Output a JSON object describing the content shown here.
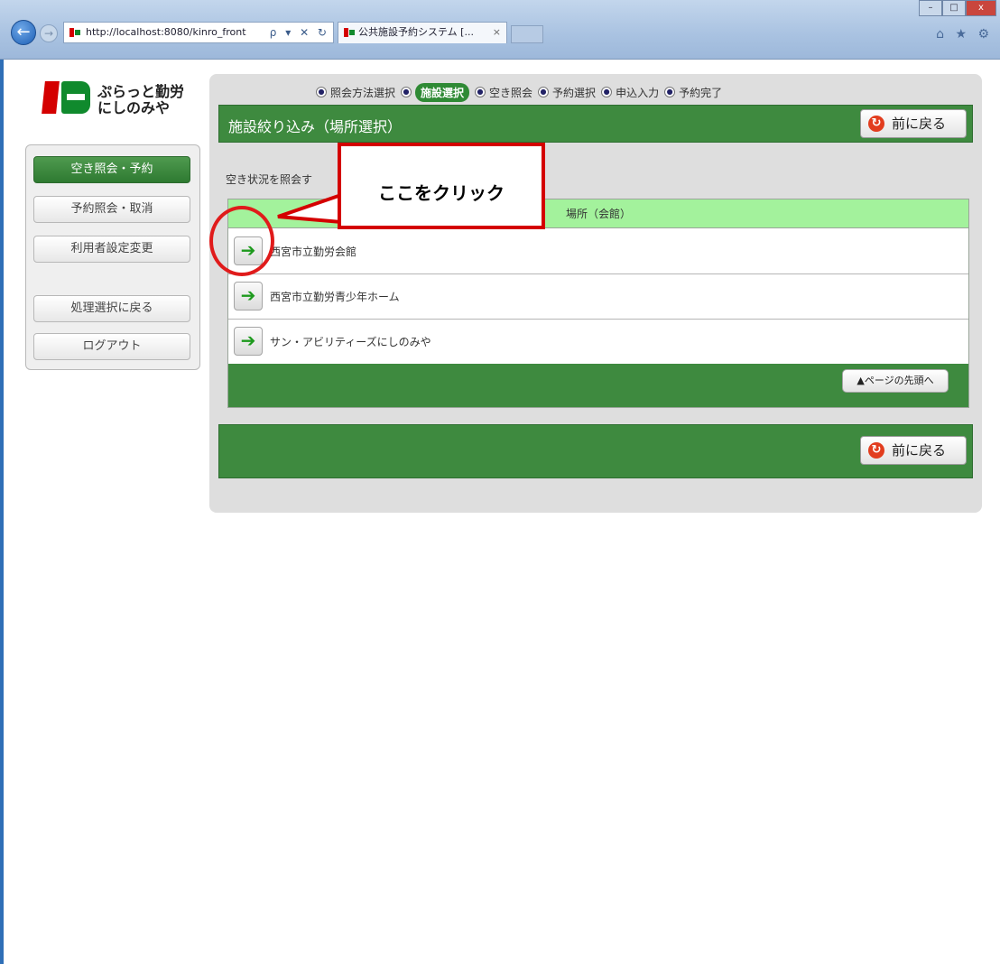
{
  "browser": {
    "url": "http://localhost:8080/kinro_front",
    "tab_title": "公共施設予約システム [...",
    "tab_close": "×",
    "back_glyph": "←",
    "forward_glyph": "→",
    "addr_icons": "ρ ▾ ✕ ↻",
    "toolbar_icons": "⌂ ★ ⚙",
    "window_buttons": {
      "minimize": "–",
      "maximize": "□",
      "close": "x"
    }
  },
  "logo": {
    "line1": "ぷらっと勤労",
    "line2": "にしのみや"
  },
  "sidebar": {
    "items": [
      {
        "label": "空き照会・予約",
        "active": true
      },
      {
        "label": "予約照会・取消",
        "active": false
      },
      {
        "label": "利用者設定変更",
        "active": false
      },
      {
        "label": "処理選択に戻る",
        "active": false
      },
      {
        "label": "ログアウト",
        "active": false
      }
    ]
  },
  "steps": [
    {
      "label": "照会方法選択",
      "current": false
    },
    {
      "label": "施設選択",
      "current": true
    },
    {
      "label": "空き照会",
      "current": false
    },
    {
      "label": "予約選択",
      "current": false
    },
    {
      "label": "申込入力",
      "current": false
    },
    {
      "label": "予約完了",
      "current": false
    }
  ],
  "header": {
    "title": "施設絞り込み（場所選択）",
    "back_label": "前に戻る",
    "back_icon_glyph": "↻"
  },
  "instruction": "空き状況を照会す",
  "table": {
    "column_header": "場所（会館）",
    "rows": [
      "西宮市立勤労会館",
      "西宮市立勤労青少年ホーム",
      "サン・アビリティーズにしのみや"
    ],
    "go_glyph": "➔",
    "top_button": "▲ページの先頭へ"
  },
  "footer": {
    "back_label": "前に戻る"
  },
  "callout": {
    "text": "ここをクリック"
  },
  "colors": {
    "accent_green": "#3e8a3f",
    "header_row_green": "#a3f29c",
    "annotation_red": "#d40000",
    "logo_red": "#d40000",
    "logo_green": "#108a2d"
  }
}
